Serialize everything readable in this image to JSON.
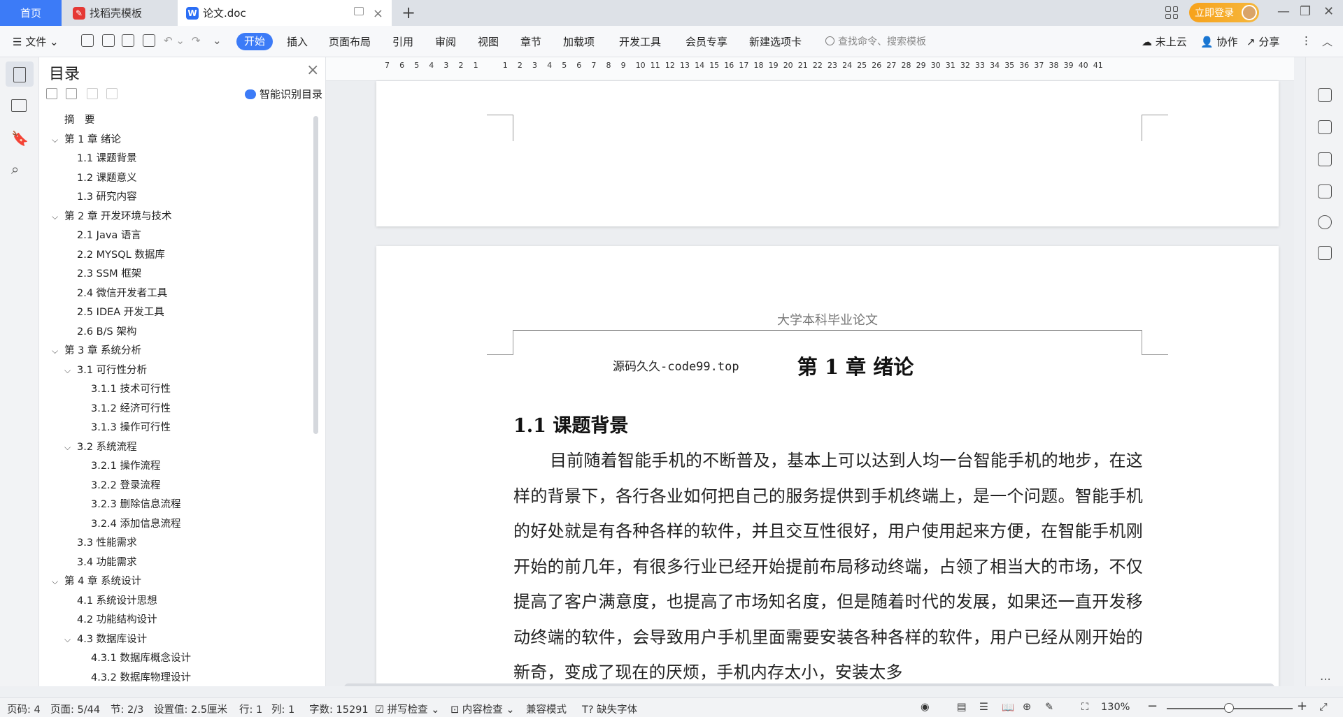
{
  "tabs": [
    {
      "label": "首页"
    },
    {
      "label": "找稻壳模板"
    },
    {
      "label": "论文.doc"
    }
  ],
  "top_right": {
    "login": "立即登录"
  },
  "toolbar": {
    "file": "文件",
    "items": [
      "开始",
      "插入",
      "页面布局",
      "引用",
      "审阅",
      "视图",
      "章节",
      "加载项",
      "开发工具",
      "会员专享",
      "新建选项卡"
    ],
    "search_placeholder": "查找命令、搜索模板",
    "cloud": "未上云",
    "collab": "协作",
    "share": "分享"
  },
  "outline": {
    "title": "目录",
    "smart": "智能识别目录",
    "items": [
      {
        "label": "摘　要",
        "level": 0,
        "chevron": false
      },
      {
        "label": "第 1 章  绪论",
        "level": 0,
        "chevron": true
      },
      {
        "label": "1.1  课题背景",
        "level": 1,
        "chevron": false
      },
      {
        "label": "1.2  课题意义",
        "level": 1,
        "chevron": false
      },
      {
        "label": "1.3  研究内容",
        "level": 1,
        "chevron": false
      },
      {
        "label": "第 2 章  开发环境与技术",
        "level": 0,
        "chevron": true
      },
      {
        "label": "2.1 Java 语言",
        "level": 1,
        "chevron": false
      },
      {
        "label": "2.2 MYSQL 数据库",
        "level": 1,
        "chevron": false
      },
      {
        "label": "2.3 SSM 框架",
        "level": 1,
        "chevron": false
      },
      {
        "label": "2.4 微信开发者工具",
        "level": 1,
        "chevron": false
      },
      {
        "label": "2.5 IDEA 开发工具",
        "level": 1,
        "chevron": false
      },
      {
        "label": "2.6 B/S 架构",
        "level": 1,
        "chevron": false
      },
      {
        "label": "第 3 章  系统分析",
        "level": 0,
        "chevron": true
      },
      {
        "label": "3.1  可行性分析",
        "level": 1,
        "chevron": true
      },
      {
        "label": "3.1.1  技术可行性",
        "level": 2,
        "chevron": false
      },
      {
        "label": "3.1.2  经济可行性",
        "level": 2,
        "chevron": false
      },
      {
        "label": "3.1.3  操作可行性",
        "level": 2,
        "chevron": false
      },
      {
        "label": "3.2  系统流程",
        "level": 1,
        "chevron": true
      },
      {
        "label": "3.2.1  操作流程",
        "level": 2,
        "chevron": false
      },
      {
        "label": "3.2.2  登录流程",
        "level": 2,
        "chevron": false
      },
      {
        "label": "3.2.3  删除信息流程",
        "level": 2,
        "chevron": false
      },
      {
        "label": "3.2.4  添加信息流程",
        "level": 2,
        "chevron": false
      },
      {
        "label": "3.3  性能需求",
        "level": 1,
        "chevron": false
      },
      {
        "label": "3.4  功能需求",
        "level": 1,
        "chevron": false
      },
      {
        "label": "第 4 章  系统设计",
        "level": 0,
        "chevron": true
      },
      {
        "label": "4.1  系统设计思想",
        "level": 1,
        "chevron": false
      },
      {
        "label": "4.2  功能结构设计",
        "level": 1,
        "chevron": false
      },
      {
        "label": "4.3  数据库设计",
        "level": 1,
        "chevron": true
      },
      {
        "label": "4.3.1  数据库概念设计",
        "level": 2,
        "chevron": false
      },
      {
        "label": "4.3.2  数据库物理设计",
        "level": 2,
        "chevron": false
      }
    ]
  },
  "ruler": {
    "ticks": [
      "7",
      "6",
      "5",
      "4",
      "3",
      "2",
      "1",
      "",
      "1",
      "2",
      "3",
      "4",
      "5",
      "6",
      "7",
      "8",
      "9",
      "10",
      "11",
      "12",
      "13",
      "14",
      "15",
      "16",
      "17",
      "18",
      "19",
      "20",
      "21",
      "22",
      "23",
      "24",
      "25",
      "26",
      "27",
      "28",
      "29",
      "30",
      "31",
      "32",
      "33",
      "34",
      "35",
      "36",
      "37",
      "38",
      "39",
      "40",
      "41"
    ]
  },
  "document": {
    "header": "大学本科毕业论文",
    "watermark": "源码久久-code99.top",
    "chapter": "第 1 章  绪论",
    "section": "1.1  课题背景",
    "paragraph": "目前随着智能手机的不断普及，基本上可以达到人均一台智能手机的地步，在这样的背景下，各行各业如何把自己的服务提供到手机终端上，是一个问题。智能手机的好处就是有各种各样的软件，并且交互性很好，用户使用起来方便，在智能手机刚开始的前几年，有很多行业已经开始提前布局移动终端，占领了相当大的市场，不仅提高了客户满意度，也提高了市场知名度，但是随着时代的发展，如果还一直开发移动终端的软件，会导致用户手机里面需要安装各种各样的软件，用户已经从刚开始的新奇，变成了现在的厌烦，手机内存太小，安装太多"
  },
  "status": {
    "page_num": "页码: 4",
    "pages": "页面: 5/44",
    "section": "节: 2/3",
    "setting": "设置值: 2.5厘米",
    "row": "行: 1",
    "col": "列: 1",
    "words": "字数: 15291",
    "spell": "拼写检查",
    "content_check": "内容检查",
    "compat": "兼容模式",
    "missing_font": "缺失字体",
    "zoom": "130%"
  }
}
